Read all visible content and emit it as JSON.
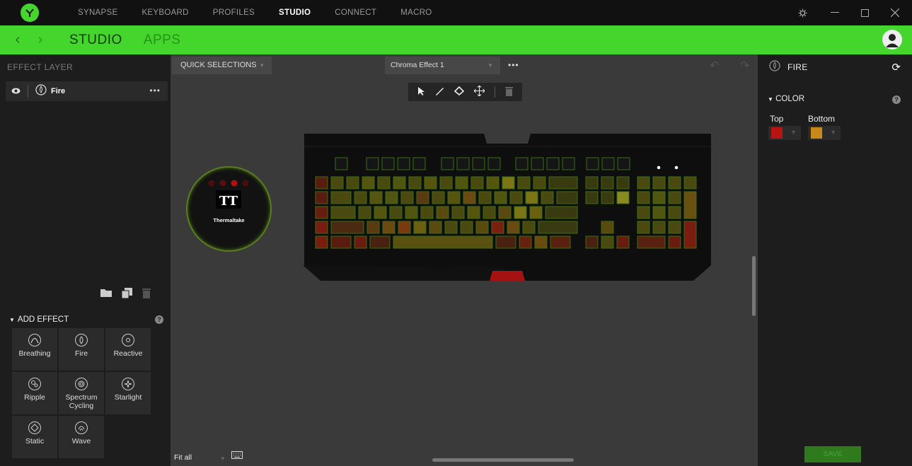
{
  "nav": {
    "items": [
      {
        "label": "SYNAPSE"
      },
      {
        "label": "KEYBOARD"
      },
      {
        "label": "PROFILES"
      },
      {
        "label": "STUDIO"
      },
      {
        "label": "CONNECT"
      },
      {
        "label": "MACRO"
      }
    ],
    "active": "STUDIO"
  },
  "subnav": {
    "tabs": [
      {
        "label": "STUDIO"
      },
      {
        "label": "APPS"
      }
    ]
  },
  "effect_layer": {
    "title": "EFFECT LAYER",
    "layers": [
      {
        "name": "Fire"
      }
    ]
  },
  "add_effect": {
    "title": "ADD EFFECT",
    "help": "?",
    "effects": [
      {
        "label": "Breathing",
        "icon": "breathing-icon"
      },
      {
        "label": "Fire",
        "icon": "fire-icon"
      },
      {
        "label": "Reactive",
        "icon": "reactive-icon"
      },
      {
        "label": "Ripple",
        "icon": "ripple-icon"
      },
      {
        "label": "Spectrum Cycling",
        "icon": "spectrum-cycling-icon"
      },
      {
        "label": "Starlight",
        "icon": "starlight-icon"
      },
      {
        "label": "Static",
        "icon": "static-icon"
      },
      {
        "label": "Wave",
        "icon": "wave-icon"
      }
    ]
  },
  "canvas": {
    "quick_selections": "QUICK SELECTIONS",
    "effect_name": "Chroma Effect 1",
    "fit_label": "Fit all",
    "mousepad_label": "Thermaltake"
  },
  "properties": {
    "title": "FIRE",
    "color_section": "COLOR",
    "help": "?",
    "top_label": "Top",
    "bottom_label": "Bottom",
    "save_label": "SAVE"
  },
  "colors": {
    "accent": "#44d62c",
    "top_color": "#b81414",
    "bottom_color": "#c8881a"
  }
}
